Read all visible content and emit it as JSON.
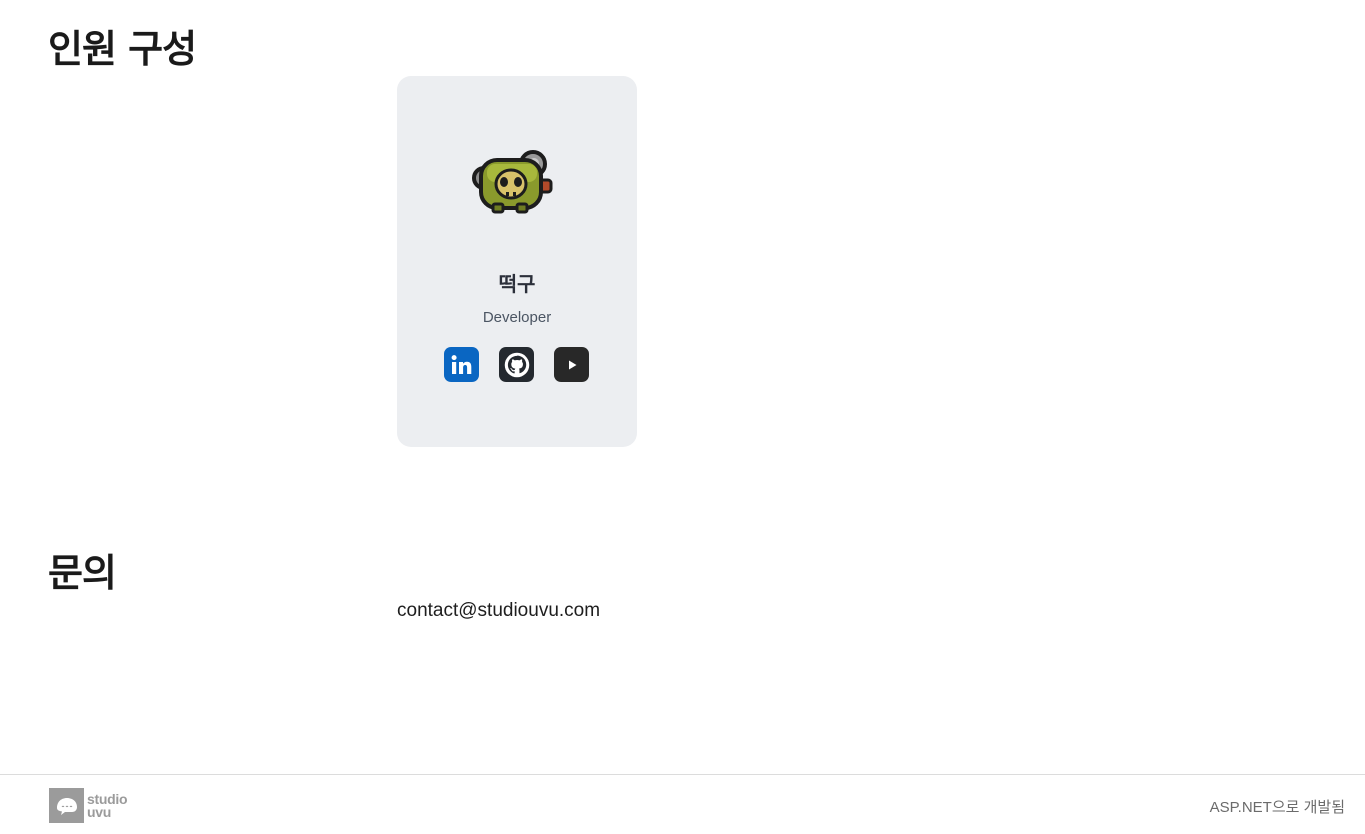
{
  "sections": {
    "members_title": "인원 구성",
    "contact_title": "문의"
  },
  "members": [
    {
      "name": "떡구",
      "role": "Developer",
      "avatar_icon": "green-zombie-creature-icon",
      "socials": [
        {
          "name": "linkedin-icon",
          "color": "#0a66c2"
        },
        {
          "name": "github-icon",
          "color": "#24292f"
        },
        {
          "name": "youtube-icon",
          "color": "#282828"
        }
      ]
    }
  ],
  "contact": {
    "email": "contact@studiouvu.com"
  },
  "footer": {
    "logo_line1": "studio",
    "logo_line2": "uvu",
    "note": "ASP.NET으로 개발됨"
  },
  "colors": {
    "card_bg": "#eceef1",
    "logo_gray": "#9b9b9b"
  }
}
